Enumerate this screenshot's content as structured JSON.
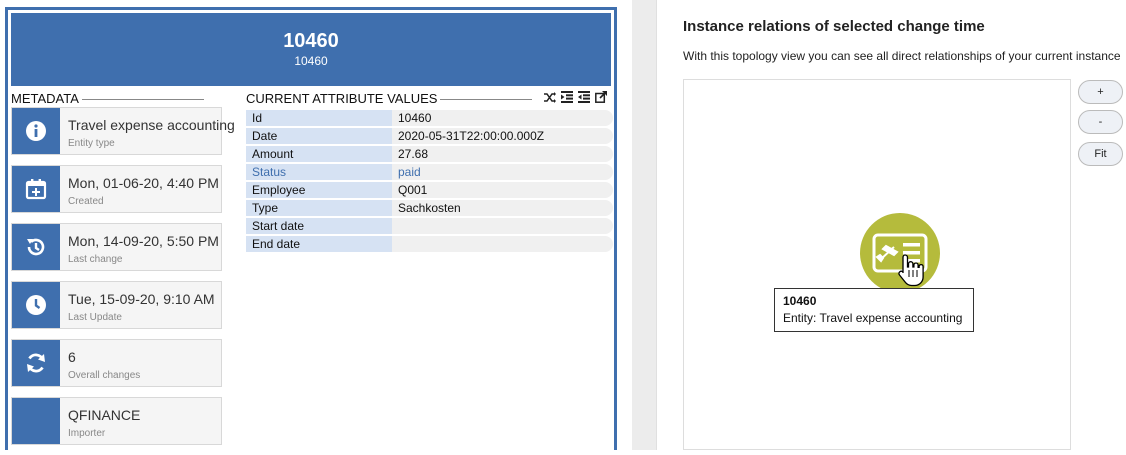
{
  "banner": {
    "title": "10460",
    "subtitle": "10460"
  },
  "metadata": {
    "title": "METADATA",
    "cards": [
      {
        "icon": "info-icon",
        "value": "Travel expense accounting",
        "label": "Entity type"
      },
      {
        "icon": "calendar-plus-icon",
        "value": "Mon, 01-06-20, 4:40 PM",
        "label": "Created"
      },
      {
        "icon": "history-icon",
        "value": "Mon, 14-09-20, 5:50 PM",
        "label": "Last change"
      },
      {
        "icon": "clock-icon",
        "value": "Tue, 15-09-20, 9:10 AM",
        "label": "Last Update"
      },
      {
        "icon": "sync-icon",
        "value": "6",
        "label": "Overall changes"
      },
      {
        "icon": "importer-icon",
        "value": "QFINANCE",
        "label": "Importer"
      }
    ]
  },
  "attributes": {
    "title": "CURRENT ATTRIBUTE VALUES",
    "rows": [
      {
        "key": "Id",
        "value": "10460"
      },
      {
        "key": "Date",
        "value": "2020-05-31T22:00:00.000Z"
      },
      {
        "key": "Amount",
        "value": "27.68"
      },
      {
        "key": "Status",
        "value": "paid"
      },
      {
        "key": "Employee",
        "value": "Q001"
      },
      {
        "key": "Type",
        "value": "Sachkosten"
      },
      {
        "key": "Start date",
        "value": ""
      },
      {
        "key": "End date",
        "value": ""
      }
    ]
  },
  "relations": {
    "title": "Instance relations of selected change time",
    "description": "With this topology view you can see all direct relationships of your current instance",
    "zoom_in": "+",
    "zoom_out": "-",
    "fit": "Fit",
    "node_icon": "travel-expense-icon",
    "tooltip": {
      "title": "10460",
      "text": "Entity: Travel expense accounting"
    }
  },
  "colors": {
    "accent": "#3f6fae",
    "node": "#b5bb3c"
  }
}
